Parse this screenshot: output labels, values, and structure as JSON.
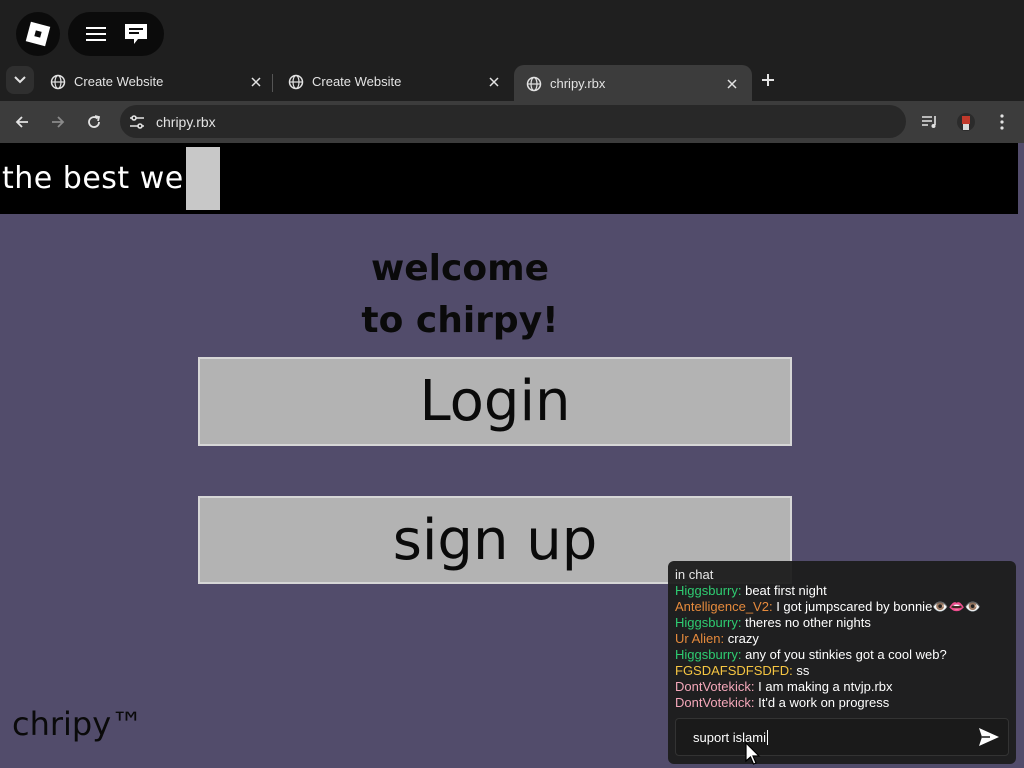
{
  "topbar": {
    "roblox_icon": "roblox-logo",
    "menu_icon": "hamburger-menu",
    "chat_icon": "chat-bubble"
  },
  "tabs": [
    {
      "title": "Create Website",
      "icon": "globe",
      "active": false
    },
    {
      "title": "Create Website",
      "icon": "globe",
      "active": false
    },
    {
      "title": "chripy.rbx",
      "icon": "globe",
      "active": true
    }
  ],
  "address_bar": {
    "url": "chripy.rbx"
  },
  "page": {
    "banner_text": "the best web",
    "welcome_line1": "welcome",
    "welcome_line2": "to chirpy!",
    "login_label": "Login",
    "signup_label": "sign up",
    "footer_brand": "chripy™"
  },
  "chat": {
    "header": "in chat",
    "messages": [
      {
        "user": "Higgsburry:",
        "text": "beat first night",
        "color": "#2ecc71"
      },
      {
        "user": "Antelligence_V2:",
        "text": "I got jumpscared by bonnie👁️👄👁️",
        "color": "#e58a3c"
      },
      {
        "user": "Higgsburry:",
        "text": "theres no other nights",
        "color": "#2ecc71"
      },
      {
        "user": "Ur Alien:",
        "text": "crazy",
        "color": "#e58a3c"
      },
      {
        "user": "Higgsburry:",
        "text": "any of you stinkies got a cool web?",
        "color": "#2ecc71"
      },
      {
        "user": "FGSDAFSDFSDFD:",
        "text": "ss",
        "color": "#f5c542"
      },
      {
        "user": "DontVotekick:",
        "text": "I am making a ntvjp.rbx",
        "color": "#f4a7b9"
      },
      {
        "user": "DontVotekick:",
        "text": "It'd a work on progress",
        "color": "#f4a7b9"
      }
    ],
    "input_value": "suport islami"
  }
}
